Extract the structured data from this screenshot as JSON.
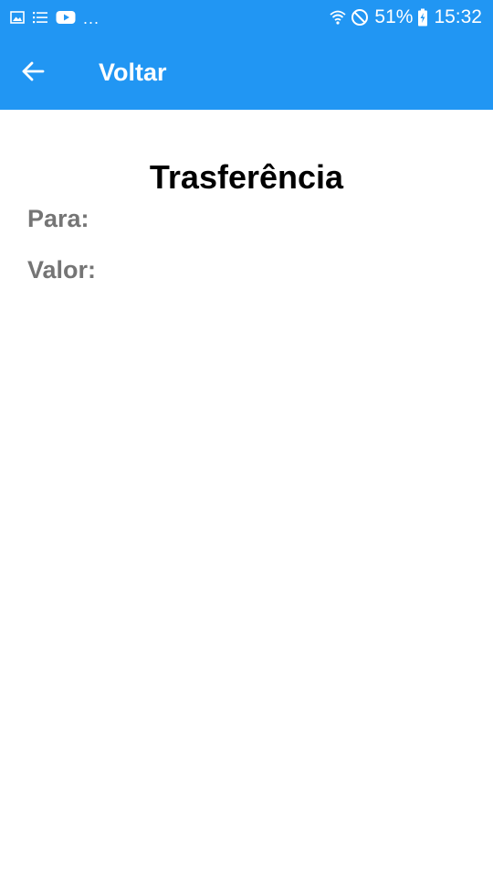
{
  "status_bar": {
    "notification_icons": [
      "gallery-icon",
      "list-icon",
      "youtube-icon"
    ],
    "overflow": "...",
    "wifi_icon": "wifi-icon",
    "dnd_icon": "do-not-disturb-icon",
    "battery_percent": "51%",
    "battery_icon": "battery-charging-icon",
    "time": "15:32"
  },
  "app_bar": {
    "back_icon": "arrow-back-icon",
    "title": "Voltar"
  },
  "main": {
    "title": "Trasferência",
    "fields": [
      {
        "label": "Para:"
      },
      {
        "label": "Valor:"
      }
    ]
  },
  "colors": {
    "primary": "#2196F3",
    "label_gray": "#757575",
    "title_black": "#000000"
  }
}
